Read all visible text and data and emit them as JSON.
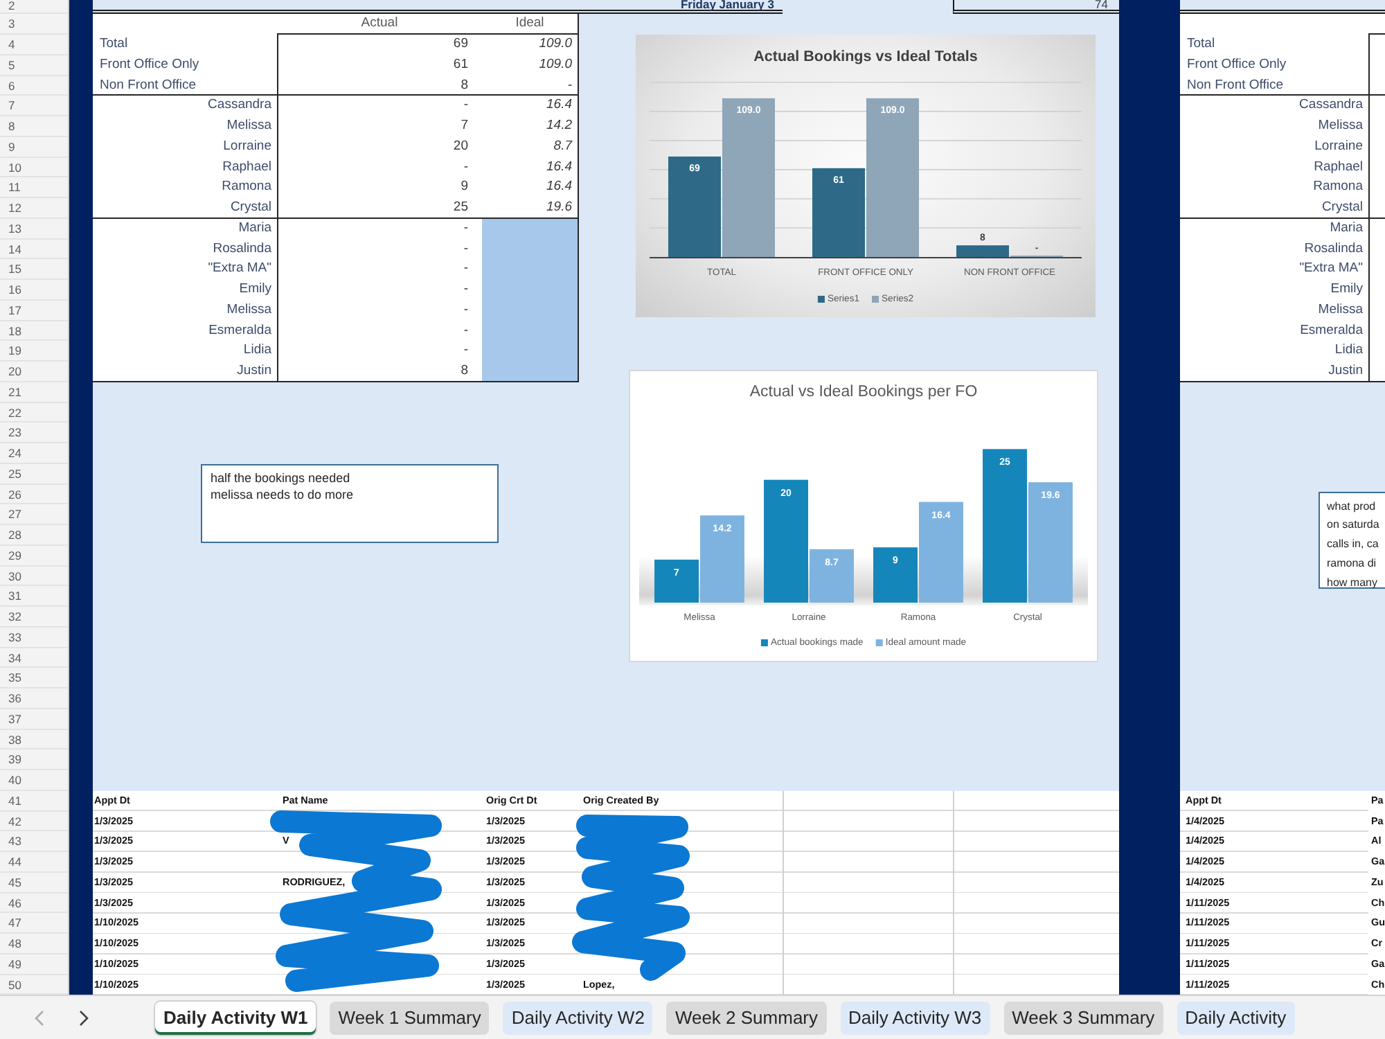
{
  "row_numbers": [
    "2",
    "3",
    "4",
    "5",
    "6",
    "7",
    "8",
    "9",
    "10",
    "11",
    "12",
    "13",
    "14",
    "15",
    "16",
    "17",
    "18",
    "19",
    "20",
    "21",
    "22",
    "23",
    "24",
    "25",
    "26",
    "27",
    "28",
    "29",
    "30",
    "31",
    "32",
    "33",
    "34",
    "35",
    "36",
    "37",
    "38",
    "39",
    "40",
    "41",
    "42",
    "43",
    "44",
    "45",
    "46",
    "47",
    "48",
    "49",
    "50"
  ],
  "summary": {
    "title": "Friday January 3",
    "side_value": "74",
    "columns": [
      "Actual",
      "Ideal"
    ],
    "groups": [
      {
        "kind": "totals",
        "rows": [
          {
            "label": "Total",
            "actual": "69",
            "ideal": "109.0"
          },
          {
            "label": "Front Office Only",
            "actual": "61",
            "ideal": "109.0"
          },
          {
            "label": "Non Front Office",
            "actual": "8",
            "ideal": "-"
          }
        ]
      },
      {
        "kind": "staff",
        "rows": [
          {
            "label": "Cassandra",
            "actual": "-",
            "ideal": "16.4"
          },
          {
            "label": "Melissa",
            "actual": "7",
            "ideal": "14.2"
          },
          {
            "label": "Lorraine",
            "actual": "20",
            "ideal": "8.7"
          },
          {
            "label": "Raphael",
            "actual": "-",
            "ideal": "16.4"
          },
          {
            "label": "Ramona",
            "actual": "9",
            "ideal": "16.4"
          },
          {
            "label": "Crystal",
            "actual": "25",
            "ideal": "19.6"
          }
        ]
      },
      {
        "kind": "extra",
        "rows": [
          {
            "label": "Maria",
            "actual": "-"
          },
          {
            "label": "Rosalinda",
            "actual": "-"
          },
          {
            "label": "\"Extra MA\"",
            "actual": "-"
          },
          {
            "label": "Emily",
            "actual": "-"
          },
          {
            "label": "Melissa",
            "actual": "-"
          },
          {
            "label": "Esmeralda",
            "actual": "-"
          },
          {
            "label": "Lidia",
            "actual": "-"
          },
          {
            "label": "Justin",
            "actual": "8"
          }
        ]
      }
    ]
  },
  "charts": [
    {
      "kind": "shaded",
      "chart_data": {
        "type": "bar",
        "title": "Actual Bookings vs Ideal Totals",
        "categories": [
          "TOTAL",
          "FRONT OFFICE ONLY",
          "NON FRONT OFFICE"
        ],
        "series": [
          {
            "name": "Series1",
            "color": "#2e6a87",
            "values": [
              69,
              61,
              8
            ],
            "value_labels": [
              "69",
              "61",
              "8"
            ]
          },
          {
            "name": "Series2",
            "color": "#8fa5b8",
            "values": [
              109,
              109,
              0
            ],
            "value_labels": [
              "109.0",
              "109.0",
              "-"
            ]
          }
        ],
        "legend": "bottom"
      }
    },
    {
      "kind": "floor",
      "chart_data": {
        "type": "bar",
        "title": "Actual vs Ideal Bookings per FO",
        "categories": [
          "Melissa",
          "Lorraine",
          "Ramona",
          "Crystal"
        ],
        "series": [
          {
            "name": "Actual bookings made",
            "color": "#1586ba",
            "values": [
              7,
              20,
              9,
              25
            ],
            "value_labels": [
              "7",
              "20",
              "9",
              "25"
            ]
          },
          {
            "name": "Ideal amount made",
            "color": "#7eb3e0",
            "values": [
              14.2,
              8.7,
              16.4,
              19.6
            ],
            "value_labels": [
              "14.2",
              "8.7",
              "16.4",
              "19.6"
            ]
          }
        ],
        "legend": "bottom"
      }
    }
  ],
  "notes": [
    {
      "text": "half the bookings needed\nmelissa needs to do more"
    }
  ],
  "bookings": {
    "columns": [
      "Appt Dt",
      "Pat Name",
      "Orig Crt Dt",
      "Orig Created By"
    ],
    "rows": [
      {
        "appt_dt": "1/3/2025",
        "orig_crt_dt": "1/3/2025"
      },
      {
        "appt_dt": "1/3/2025",
        "pat_name": "V",
        "orig_crt_dt": "1/3/2025"
      },
      {
        "appt_dt": "1/3/2025",
        "orig_crt_dt": "1/3/2025"
      },
      {
        "appt_dt": "1/3/2025",
        "pat_name": "RODRIGUEZ,",
        "orig_crt_dt": "1/3/2025"
      },
      {
        "appt_dt": "1/3/2025",
        "orig_crt_dt": "1/3/2025"
      },
      {
        "appt_dt": "1/10/2025",
        "orig_crt_dt": "1/3/2025"
      },
      {
        "appt_dt": "1/10/2025",
        "orig_crt_dt": "1/3/2025"
      },
      {
        "appt_dt": "1/10/2025",
        "orig_crt_dt": "1/3/2025"
      },
      {
        "appt_dt": "1/10/2025",
        "orig_crt_dt": "1/3/2025",
        "orig_created_by": "Lopez,"
      }
    ]
  },
  "next_day": {
    "groups": [
      {
        "kind": "totals",
        "labels": [
          "Total",
          "Front Office Only",
          "Non Front Office"
        ]
      },
      {
        "kind": "staff",
        "labels": [
          "Cassandra",
          "Melissa",
          "Lorraine",
          "Raphael",
          "Ramona",
          "Crystal"
        ]
      },
      {
        "kind": "extra",
        "labels": [
          "Maria",
          "Rosalinda",
          "\"Extra MA\"",
          "Emily",
          "Melissa",
          "Esmeralda",
          "Lidia",
          "Justin"
        ]
      }
    ],
    "note": "what prod\non saturda\ncalls in, ca\nramona di\nhow many",
    "bookings": {
      "columns": [
        "Appt Dt",
        "Pa"
      ],
      "rows": [
        {
          "appt_dt": "1/4/2025",
          "column_2": "Pa"
        },
        {
          "appt_dt": "1/4/2025",
          "column_2": "Al"
        },
        {
          "appt_dt": "1/4/2025",
          "column_2": "Ga"
        },
        {
          "appt_dt": "1/4/2025",
          "column_2": "Zu"
        },
        {
          "appt_dt": "1/11/2025",
          "column_2": "Ch"
        },
        {
          "appt_dt": "1/11/2025",
          "column_2": "Gu"
        },
        {
          "appt_dt": "1/11/2025",
          "column_2": "Cr"
        },
        {
          "appt_dt": "1/11/2025",
          "column_2": "Ga"
        },
        {
          "appt_dt": "1/11/2025",
          "column_2": "Ch"
        }
      ]
    }
  },
  "sheet_tabs": {
    "nav": [
      {
        "kind": "previous",
        "disabled": true
      },
      {
        "kind": "next",
        "disabled": false
      }
    ],
    "tabs": [
      {
        "label": "Daily Activity W1",
        "selected": true
      },
      {
        "label": "Week 1 Summary",
        "selected": false,
        "color": "#dadada"
      },
      {
        "label": "Daily Activity W2",
        "selected": false,
        "color": "#dde9f8"
      },
      {
        "label": "Week 2 Summary",
        "selected": false,
        "color": "#dadada"
      },
      {
        "label": "Daily Activity W3",
        "selected": false,
        "color": "#dde9f8"
      },
      {
        "label": "Week 3 Summary",
        "selected": false,
        "color": "#dadada"
      },
      {
        "label": "Daily Activity",
        "selected": false,
        "color": "#dde9f8"
      }
    ]
  }
}
